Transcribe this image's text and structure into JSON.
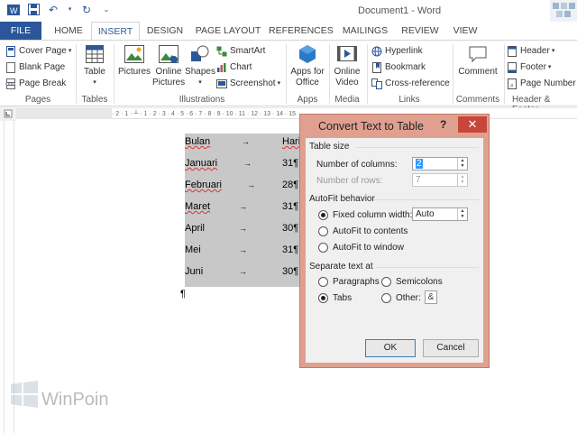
{
  "window": {
    "title": "Document1 - Word"
  },
  "tabs": [
    {
      "label": "FILE"
    },
    {
      "label": "HOME"
    },
    {
      "label": "INSERT"
    },
    {
      "label": "DESIGN"
    },
    {
      "label": "PAGE LAYOUT"
    },
    {
      "label": "REFERENCES"
    },
    {
      "label": "MAILINGS"
    },
    {
      "label": "REVIEW"
    },
    {
      "label": "VIEW"
    }
  ],
  "active_tab": "INSERT",
  "ribbon": {
    "pages": {
      "label": "Pages",
      "cover_page": "Cover Page",
      "blank_page": "Blank Page",
      "page_break": "Page Break"
    },
    "tables": {
      "label": "Tables",
      "table": "Table"
    },
    "illustrations": {
      "label": "Illustrations",
      "pictures": "Pictures",
      "online_pictures_1": "Online",
      "online_pictures_2": "Pictures",
      "shapes": "Shapes",
      "smartart": "SmartArt",
      "chart": "Chart",
      "screenshot": "Screenshot"
    },
    "apps": {
      "label": "Apps",
      "apps_for_office_1": "Apps for",
      "apps_for_office_2": "Office"
    },
    "media": {
      "label": "Media",
      "online_video_1": "Online",
      "online_video_2": "Video"
    },
    "links": {
      "label": "Links",
      "hyperlink": "Hyperlink",
      "bookmark": "Bookmark",
      "cross_reference": "Cross-reference"
    },
    "comments": {
      "label": "Comments",
      "comment": "Comment"
    },
    "header_footer": {
      "label": "Header & Footer",
      "header": "Header",
      "footer": "Footer",
      "page_number": "Page Number"
    }
  },
  "ruler": {
    "marks": "· 2 · 1 · ┴ · 1 · 2 · 3 · 4 · 5 · 6 · 7 · 8 · 9 · 10 · 11 · 12 · 13 · 14 · 15"
  },
  "document": {
    "rows": [
      {
        "month": "Bulan",
        "days": "Hari"
      },
      {
        "month": "Januari",
        "days": "31¶"
      },
      {
        "month": "Februari",
        "days": "28¶"
      },
      {
        "month": "Maret",
        "days": "31¶"
      },
      {
        "month": "April",
        "days": "30¶"
      },
      {
        "month": "Mei",
        "days": "31¶"
      },
      {
        "month": "Juni",
        "days": "30¶"
      }
    ],
    "tab_arrow": "→",
    "end_pilcrow": "¶"
  },
  "watermark": {
    "text": "WinPoin"
  },
  "dialog": {
    "title": "Convert Text to Table",
    "help": "?",
    "close": "✕",
    "table_size_label": "Table size",
    "columns_label": "Number of columns:",
    "columns_value": "2",
    "rows_label": "Number of rows:",
    "rows_value": "7",
    "autofit_label": "AutoFit behavior",
    "fixed_width_label": "Fixed column width:",
    "fixed_width_value": "Auto",
    "autofit_contents_label": "AutoFit to contents",
    "autofit_window_label": "AutoFit to window",
    "separate_label": "Separate text at",
    "paragraphs_label": "Paragraphs",
    "semicolons_label": "Semicolons",
    "tabs_label": "Tabs",
    "other_label": "Other:",
    "other_value": "&",
    "ok_label": "OK",
    "cancel_label": "Cancel"
  },
  "colors": {
    "accent": "#2b579a",
    "dialog_frame": "#e0a090",
    "close_button": "#c7463a"
  }
}
